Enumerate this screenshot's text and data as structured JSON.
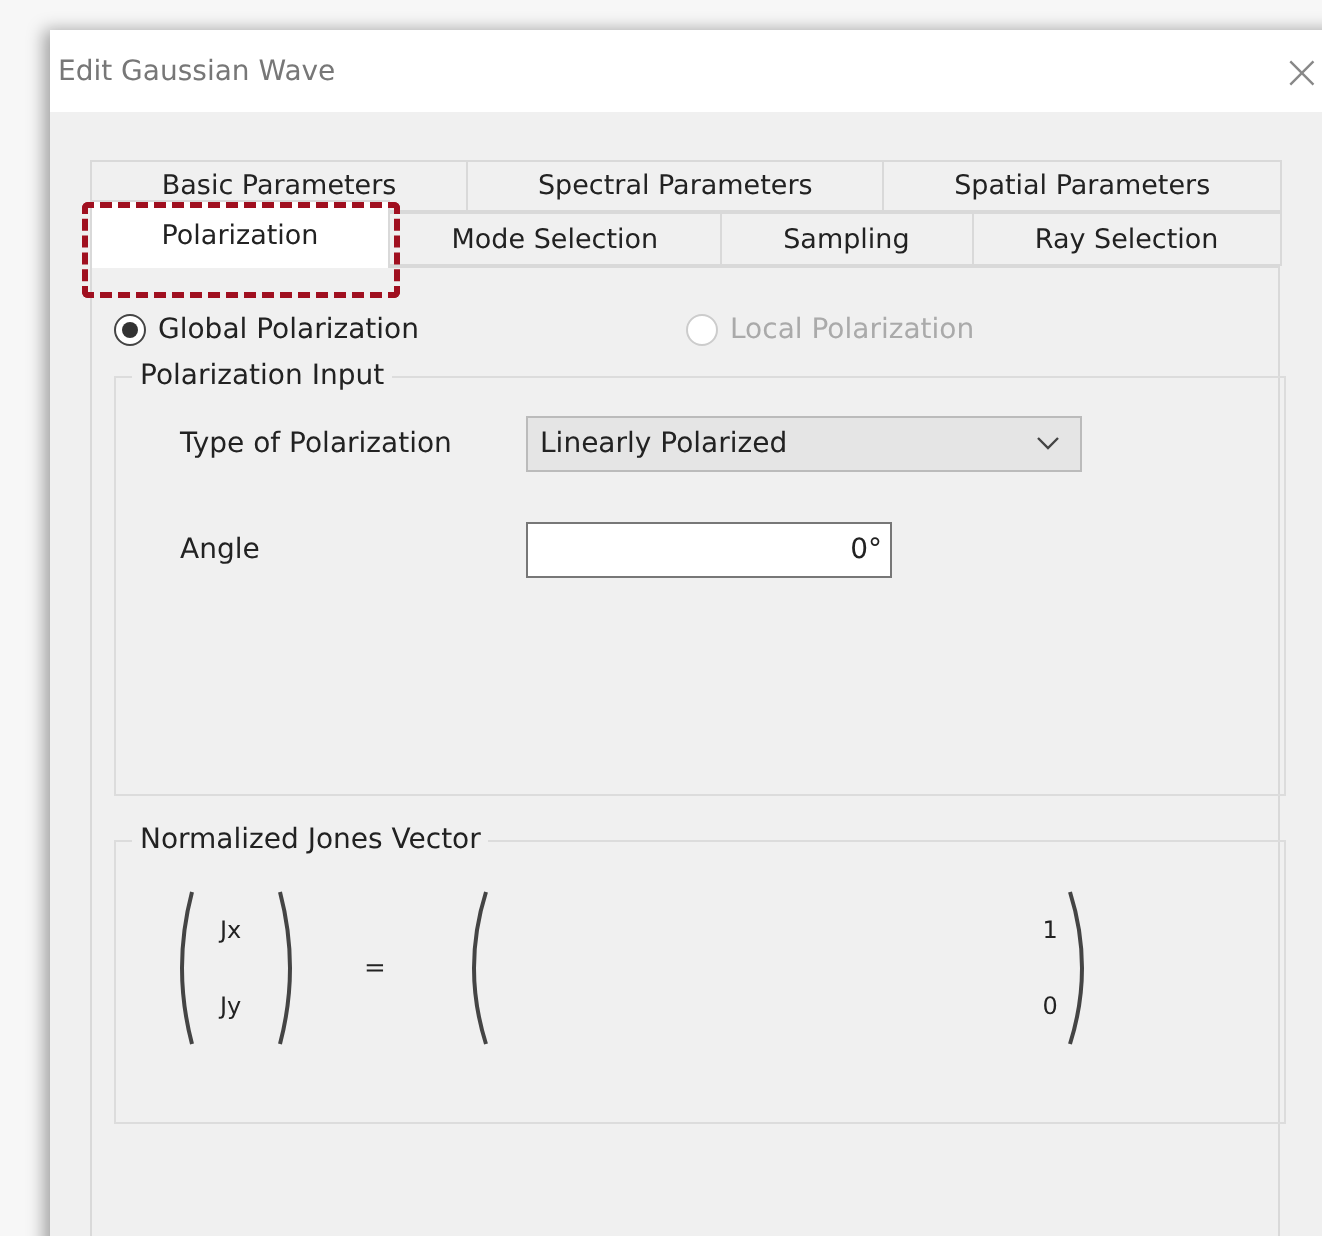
{
  "window": {
    "title": "Edit Gaussian Wave",
    "close": "×"
  },
  "tab_rows": [
    [
      {
        "label": "Basic Parameters",
        "selected": false
      },
      {
        "label": "Spectral Parameters",
        "selected": false
      },
      {
        "label": "Spatial Parameters",
        "selected": false
      }
    ],
    [
      {
        "label": "Polarization",
        "selected": true
      },
      {
        "label": "Mode Selection",
        "selected": false
      },
      {
        "label": "Sampling",
        "selected": false
      },
      {
        "label": "Ray Selection",
        "selected": false
      }
    ]
  ],
  "mode_options": [
    {
      "label": "Global Polarization",
      "selected": true,
      "disabled": false
    },
    {
      "label": "Local Polarization",
      "selected": false,
      "disabled": true
    }
  ],
  "polarization_input": {
    "title": "Polarization Input",
    "type_label": "Type of Polarization",
    "type_value": "Linearly Polarized",
    "angle_label": "Angle",
    "angle_value": "0°"
  },
  "jones_vector": {
    "title": "Normalized Jones Vector",
    "components": [
      "Jx",
      "Jy"
    ],
    "equals": "=",
    "values": [
      "1",
      "0"
    ]
  }
}
